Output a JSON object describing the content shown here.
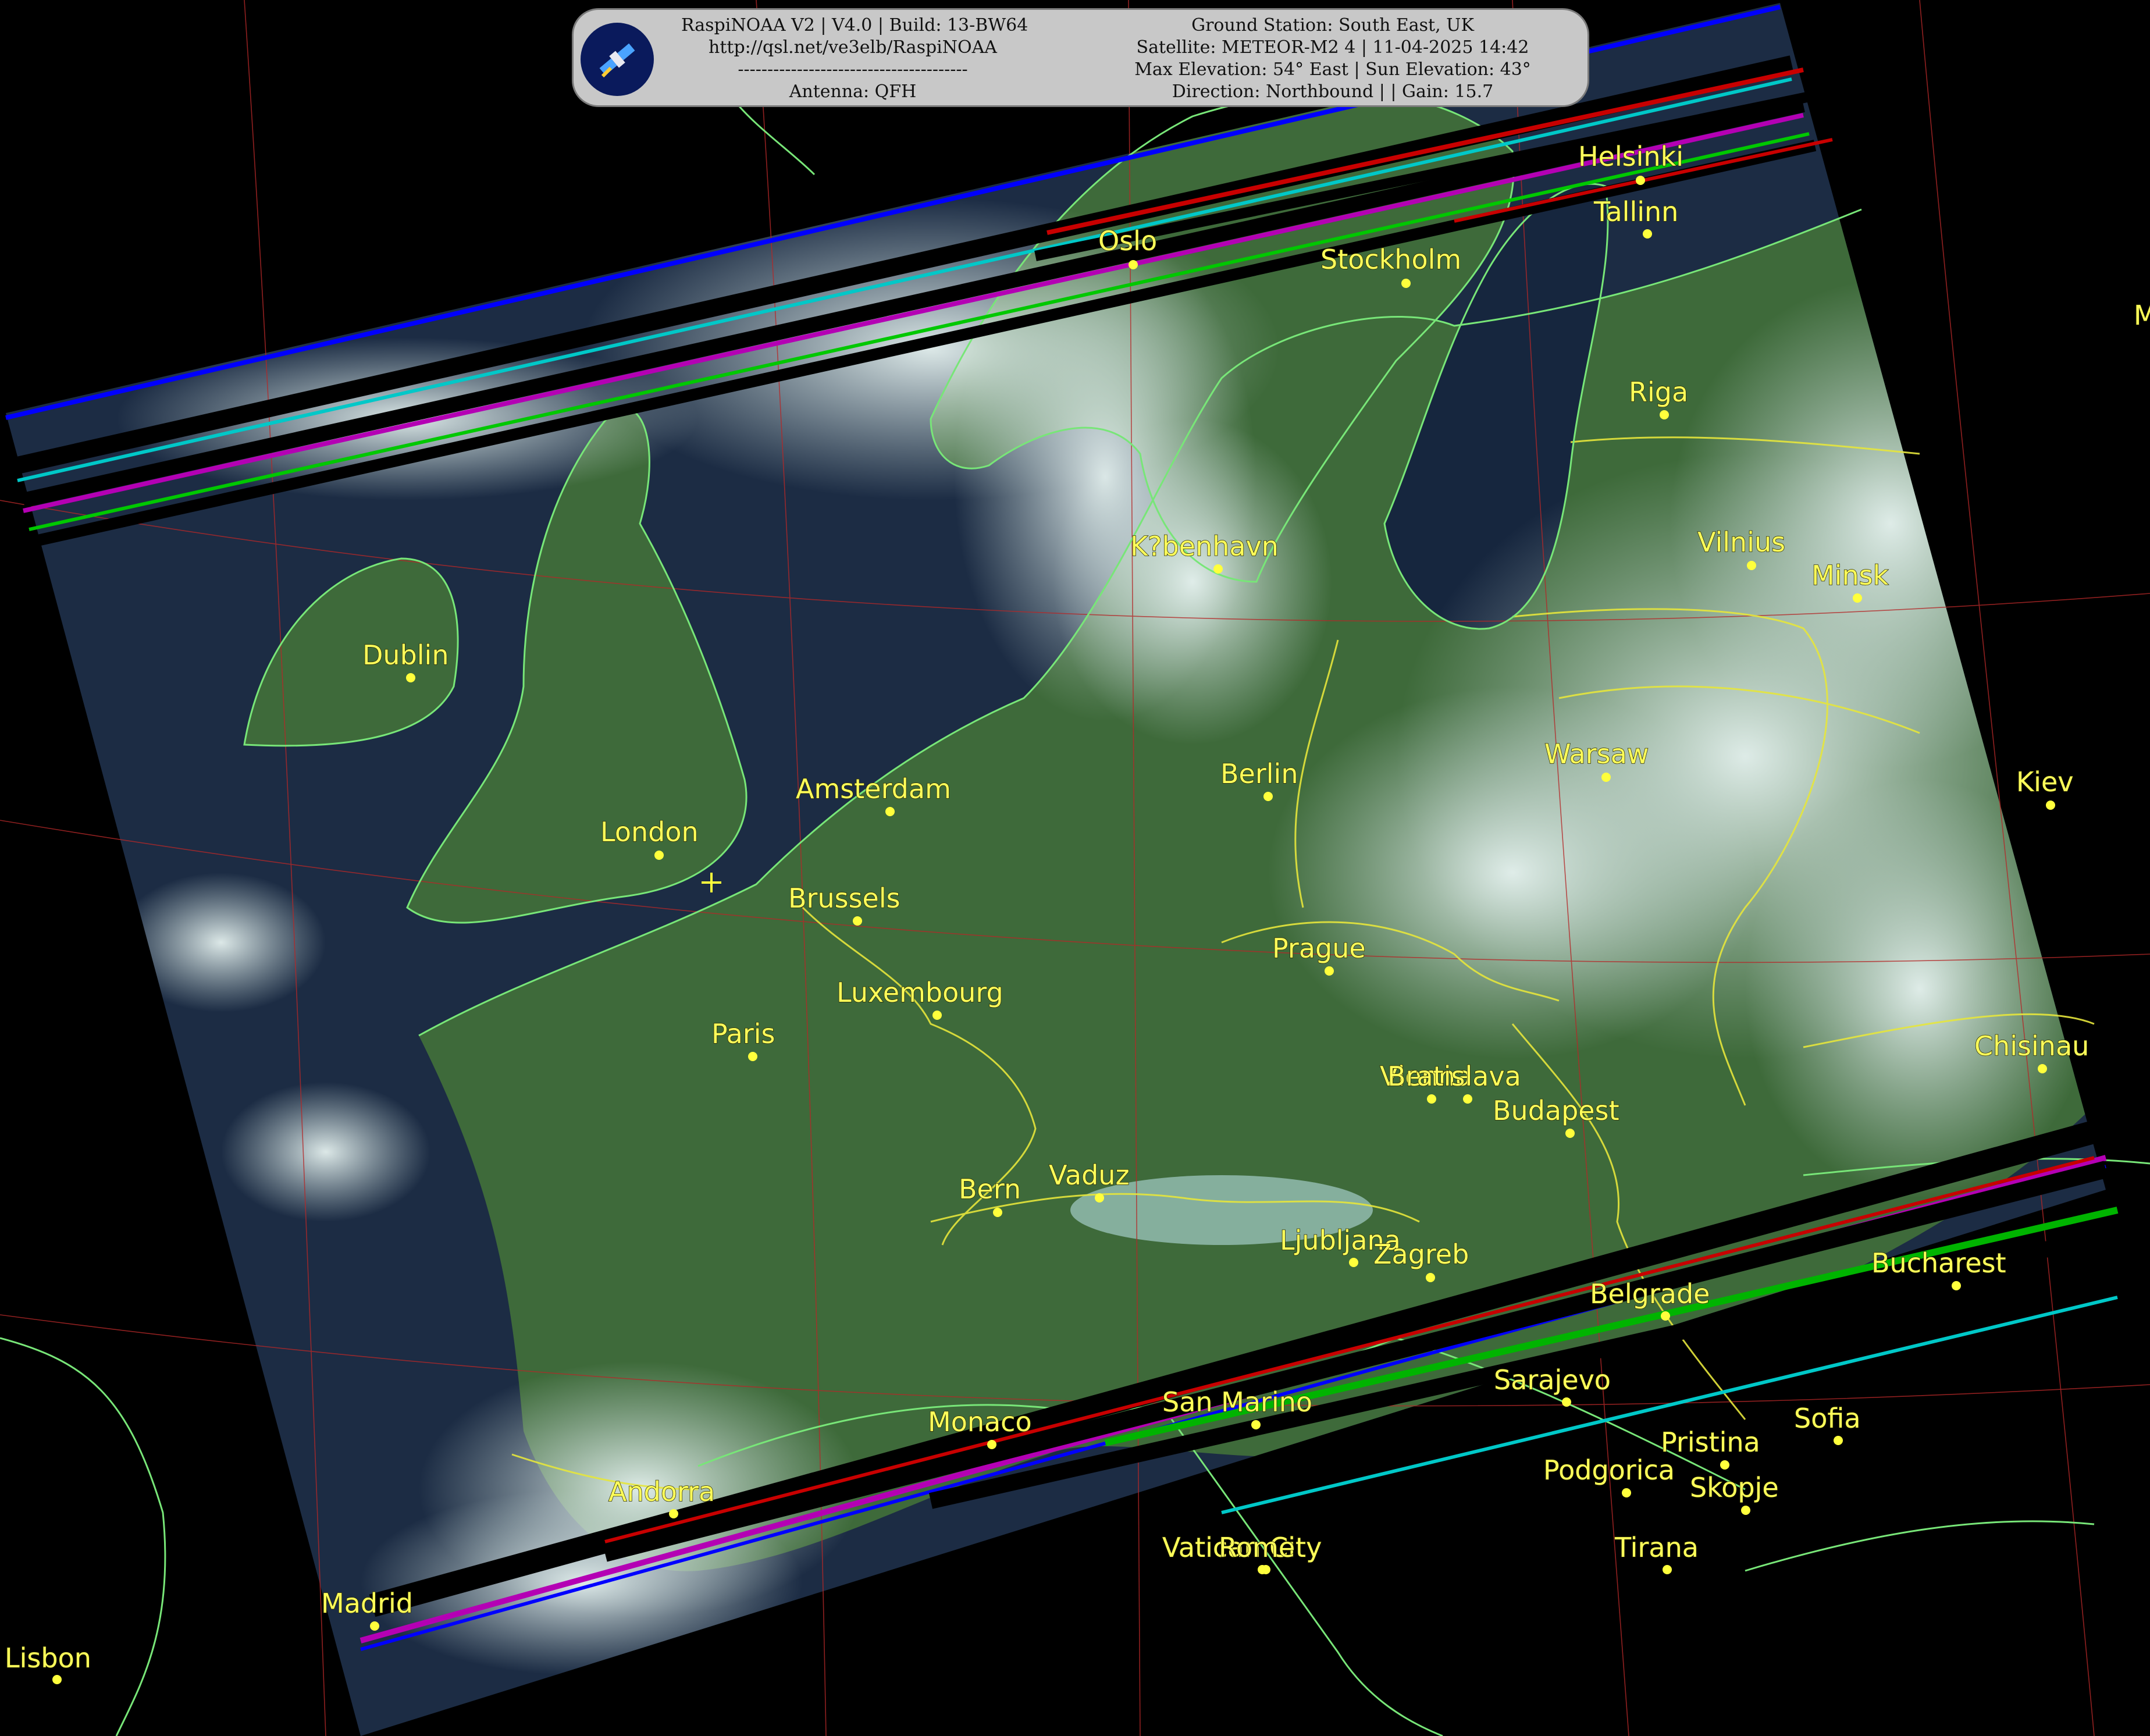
{
  "header": {
    "line1_left": "RaspiNOAA V2 | V4.0 | Build: 13-BW64",
    "line2_left": "http://qsl.net/ve3elb/RaspiNOAA",
    "line3_left": "---------------------------------------",
    "line4_left": "Antenna: QFH",
    "line1_right": "Ground Station: South East, UK",
    "line2_right": "Satellite: METEOR-M2 4 | 11-04-2025 14:42",
    "line3_right": "Max Elevation: 54° East | Sun Elevation: 43°",
    "line4_right": "Direction: Northbound | | Gain: 15.7"
  },
  "icons": {
    "logo": "satellite-icon",
    "ground_station": "crosshair-icon"
  },
  "colors": {
    "city": "#ffff3c",
    "border_country": "#e6e63c",
    "coastline": "#78e678",
    "grid": "#b42828",
    "land": "#3e6a3a",
    "sea": "#1c2c44",
    "cloud": "#c8dad8"
  },
  "cities": [
    {
      "name": "Helsinki"
    },
    {
      "name": "Tallinn"
    },
    {
      "name": "Oslo"
    },
    {
      "name": "Stockholm"
    },
    {
      "name": "Riga"
    },
    {
      "name": "K?benhavn"
    },
    {
      "name": "Vilnius"
    },
    {
      "name": "Minsk"
    },
    {
      "name": "Dublin"
    },
    {
      "name": "Berlin"
    },
    {
      "name": "Warsaw"
    },
    {
      "name": "Kiev"
    },
    {
      "name": "Amsterdam"
    },
    {
      "name": "London"
    },
    {
      "name": "Brussels"
    },
    {
      "name": "Prague"
    },
    {
      "name": "Luxembourg"
    },
    {
      "name": "Paris"
    },
    {
      "name": "Chisinau"
    },
    {
      "name": "Vienna"
    },
    {
      "name": "Bratislava"
    },
    {
      "name": "Budapest"
    },
    {
      "name": "Bern"
    },
    {
      "name": "Vaduz"
    },
    {
      "name": "Ljubljana"
    },
    {
      "name": "Zagreb"
    },
    {
      "name": "Bucharest"
    },
    {
      "name": "Belgrade"
    },
    {
      "name": "Sarajevo"
    },
    {
      "name": "Monaco"
    },
    {
      "name": "San Marino"
    },
    {
      "name": "Sofia"
    },
    {
      "name": "Pristina"
    },
    {
      "name": "Podgorica"
    },
    {
      "name": "Skopje"
    },
    {
      "name": "Andorra"
    },
    {
      "name": "Vatican City"
    },
    {
      "name": "Rome"
    },
    {
      "name": "Tirana"
    },
    {
      "name": "Madrid"
    },
    {
      "name": "Lisbon"
    }
  ],
  "edge_label": "M"
}
